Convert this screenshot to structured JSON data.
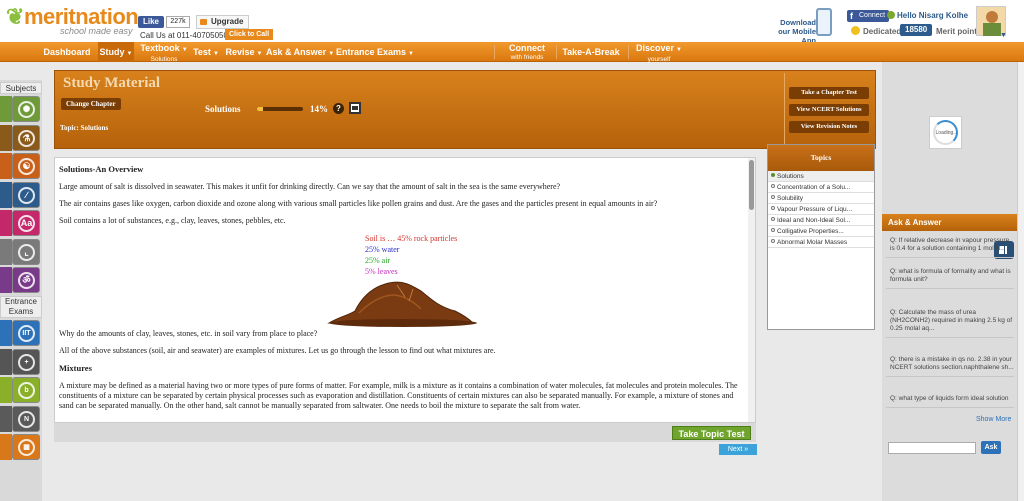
{
  "header": {
    "logo": "meritnation",
    "tagline": "school made easy",
    "fb_like": "Like",
    "fb_count": "227k",
    "upgrade": "Upgrade",
    "call_us": "Call Us at 011-40705050  or",
    "click_to_call": "Click to Call",
    "mobile_app": "Download our Mobile App",
    "fb_connect": "Connect",
    "greeting": "Hello Nisarg Kolhe",
    "dedicated": "Dedicated",
    "merit_points_value": "18580",
    "merit_points_label": "Merit points"
  },
  "nav": {
    "dashboard": "Dashboard",
    "study": "Study",
    "textbook": "Textbook",
    "textbook_sub": "Solutions",
    "test": "Test",
    "revise": "Revise",
    "ask_answer": "Ask & Answer",
    "entrance_exams": "Entrance Exams",
    "connect": "Connect",
    "connect_sub": "with friends",
    "take_a_break": "Take-A-Break",
    "discover": "Discover",
    "discover_sub": "yourself"
  },
  "left_rail": {
    "subjects_label": "Subjects",
    "entrance_label": "Entrance Exams",
    "subject_icons": [
      {
        "icon": "atom-icon",
        "color": "#6f9a3a",
        "glyph": "✺"
      },
      {
        "icon": "flask-icon",
        "color": "#8a5a1a",
        "glyph": "⚗"
      },
      {
        "icon": "biology-icon",
        "color": "#c9601a",
        "glyph": "☯"
      },
      {
        "icon": "math-icon",
        "color": "#2d5b8c",
        "glyph": "∕"
      },
      {
        "icon": "english-icon",
        "color": "#c4286a",
        "glyph": "Aa"
      },
      {
        "icon": "graph-icon",
        "color": "#7a7a7a",
        "glyph": "⌞"
      },
      {
        "icon": "hindi-icon",
        "color": "#7a3a8a",
        "glyph": "ॐ"
      }
    ],
    "exam_icons": [
      {
        "icon": "iit-icon",
        "color": "#2d72b8",
        "glyph": "IIT"
      },
      {
        "icon": "plus-icon",
        "color": "#555555",
        "glyph": "+"
      },
      {
        "icon": "bitsat-icon",
        "color": "#8ab02a",
        "glyph": "b"
      },
      {
        "icon": "ncert-icon",
        "color": "#5a5a5a",
        "glyph": "N"
      },
      {
        "icon": "calculator-icon",
        "color": "#d8781a",
        "glyph": "▦"
      }
    ]
  },
  "study_header": {
    "title": "Study Material",
    "change_chapter": "Change Chapter",
    "topic_line": "Topic: Solutions",
    "chapter": "Solutions",
    "progress_percent": 14,
    "progress_label": "14%",
    "help": "?",
    "take_chapter_test": "Take a Chapter Test",
    "view_ncert": "View NCERT Solutions",
    "view_revision": "View Revision Notes"
  },
  "content": {
    "heading": "Solutions-An Overview",
    "p1": "Large amount of salt is dissolved in seawater. This makes it unfit for drinking directly. Can we say that the amount of salt in the sea is the same everywhere?",
    "p2": "The air contains gases like oxygen, carbon dioxide and ozone along with various small particles like pollen grains and dust. Are the gases and the particles present in equal amounts in air?",
    "p3": "Soil contains a lot of substances, e.g., clay, leaves, stones, pebbles, etc.",
    "legend": [
      {
        "text": "Soil is … 45% rock particles",
        "color": "#d0332d"
      },
      {
        "text": "25% water",
        "color": "#2a2ad0"
      },
      {
        "text": "25% air",
        "color": "#2aa52a"
      },
      {
        "text": "5% leaves",
        "color": "#c62ac6"
      }
    ],
    "p4": "Why do the amounts of clay, leaves, stones, etc. in soil vary from place to place?",
    "p5": "All of the above substances (soil, air and seawater) are examples of mixtures. Let us go through the lesson to find out what mixtures are.",
    "heading2": "Mixtures",
    "p6": "A mixture may be defined as a material having two or more types of pure forms of matter. For example, milk is a mixture as it contains a combination of water molecules, fat molecules and protein molecules. The constituents of a mixture can be separated by certain physical processes such as evaporation and distillation. Constituents of certain mixtures can also be separated manually. For example, a mixture of stones and sand can be separated manually. On the other hand, salt cannot be manually separated from saltwater. One needs to boil the mixture to separate the salt from water.",
    "take_topic_test": "Take Topic Test",
    "next": "Next »"
  },
  "topics": {
    "heading": "Topics",
    "items": [
      "Solutions",
      "Concentration of a Solu...",
      "Solubility",
      "Vapour Pressure of Liqu...",
      "Ideal and Non-Ideal Sol...",
      "Colligative Properties...",
      "Abnormal Molar Masses"
    ]
  },
  "right": {
    "loading": "Loading...",
    "ask_answer_title": "Ask & Answer",
    "questions": [
      "Q: If relative decrease in vapour pressure is 0.4 for a solution containing 1 mol N...",
      "Q: what is formula of formality and what is formula unit?",
      "Q: Calculate the mass of urea (NH2CONH2) required in making 2.5 kg of 0.25 molal aq...",
      "Q: there is a mistake in qs no. 2.38 in your NCERT solutions section.naphthalene sh...",
      "Q: what type of liquids form ideal solution"
    ],
    "show_more": "Show More",
    "ask_button": "Ask"
  }
}
